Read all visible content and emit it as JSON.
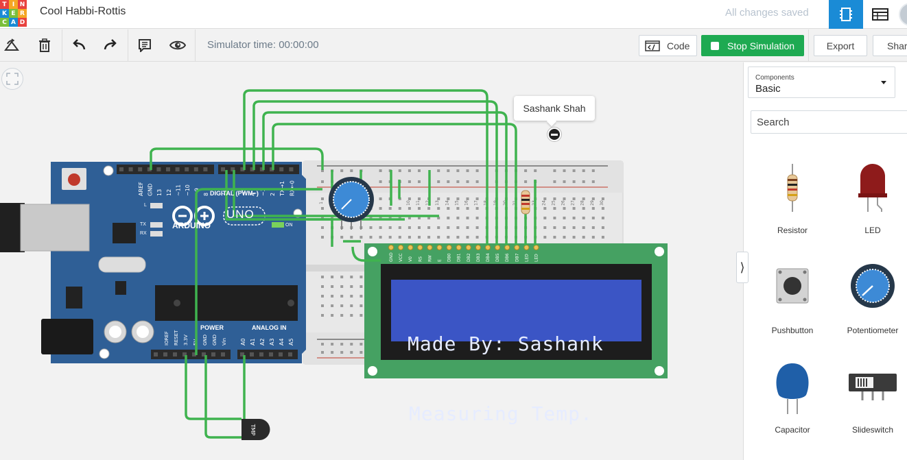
{
  "header": {
    "logo_letters": [
      "T",
      "I",
      "N",
      "K",
      "E",
      "R",
      "C",
      "A",
      "D"
    ],
    "design_title": "Cool Habbi-Rottis",
    "save_status": "All changes saved",
    "views": [
      {
        "name": "circuit-view",
        "icon": "circuit-board-icon",
        "active": true
      },
      {
        "name": "components-list",
        "icon": "table-list-icon",
        "active": false
      }
    ]
  },
  "toolbar": {
    "tools": [
      "rotate-icon",
      "trash-icon",
      "undo-icon",
      "redo-icon",
      "notes-icon",
      "eye-icon"
    ],
    "simulator_time": "Simulator time: 00:00:00",
    "code_label": "Code",
    "stop_label": "Stop Simulation",
    "export_label": "Export",
    "share_label": "Shar"
  },
  "canvas": {
    "tooltip": "Sashank Shah",
    "arduino": {
      "brand": "ARDUINO",
      "model": "UNO",
      "digital_label": "DIGITAL (PWM~)",
      "power_label": "POWER",
      "analog_label": "ANALOG IN",
      "on_label": "ON",
      "tx_label": "TX",
      "rx_label": "RX",
      "l_label": "L",
      "top_pins": [
        "AREF",
        "GND",
        "13",
        "12",
        "~11",
        "~10",
        "~9",
        "8",
        "7",
        "~6",
        "~5",
        "4",
        "~3",
        "2",
        "TX→1",
        "RX←0"
      ],
      "power_pins": [
        "IOREF",
        "RESET",
        "3.3V",
        "5V",
        "GND",
        "GND",
        "Vin"
      ],
      "analog_pins": [
        "A0",
        "A1",
        "A2",
        "A3",
        "A4",
        "A5"
      ]
    },
    "lcd": {
      "line1": "Made By: Sashank",
      "line2": "Measuring Temp.",
      "pins": [
        "GND",
        "VCC",
        "V0",
        "RS",
        "RW",
        "E",
        "DB0",
        "DB1",
        "DB2",
        "DB3",
        "DB4",
        "DB5",
        "DB6",
        "DB7",
        "LED",
        "LED"
      ]
    },
    "sensor_label": "TMP",
    "breadboard_cols": [
      "1",
      "5",
      "10",
      "11",
      "12",
      "13",
      "14",
      "15",
      "16",
      "17",
      "18",
      "19",
      "20",
      "21",
      "22",
      "23",
      "24",
      "25",
      "26",
      "27",
      "28",
      "29",
      "30"
    ]
  },
  "panel": {
    "select_label": "Components",
    "select_value": "Basic",
    "search_placeholder": "Search",
    "components": [
      "Resistor",
      "LED",
      "Pushbutton",
      "Potentiometer",
      "Capacitor",
      "Slideswitch"
    ]
  },
  "colors": {
    "accent_blue": "#1a8bd6",
    "stop_green": "#1eaa52",
    "wire_green": "#3fb34f",
    "arduino_blue": "#2f5f96",
    "lcd_board": "#45a162",
    "lcd_screen": "#3b55c5"
  }
}
